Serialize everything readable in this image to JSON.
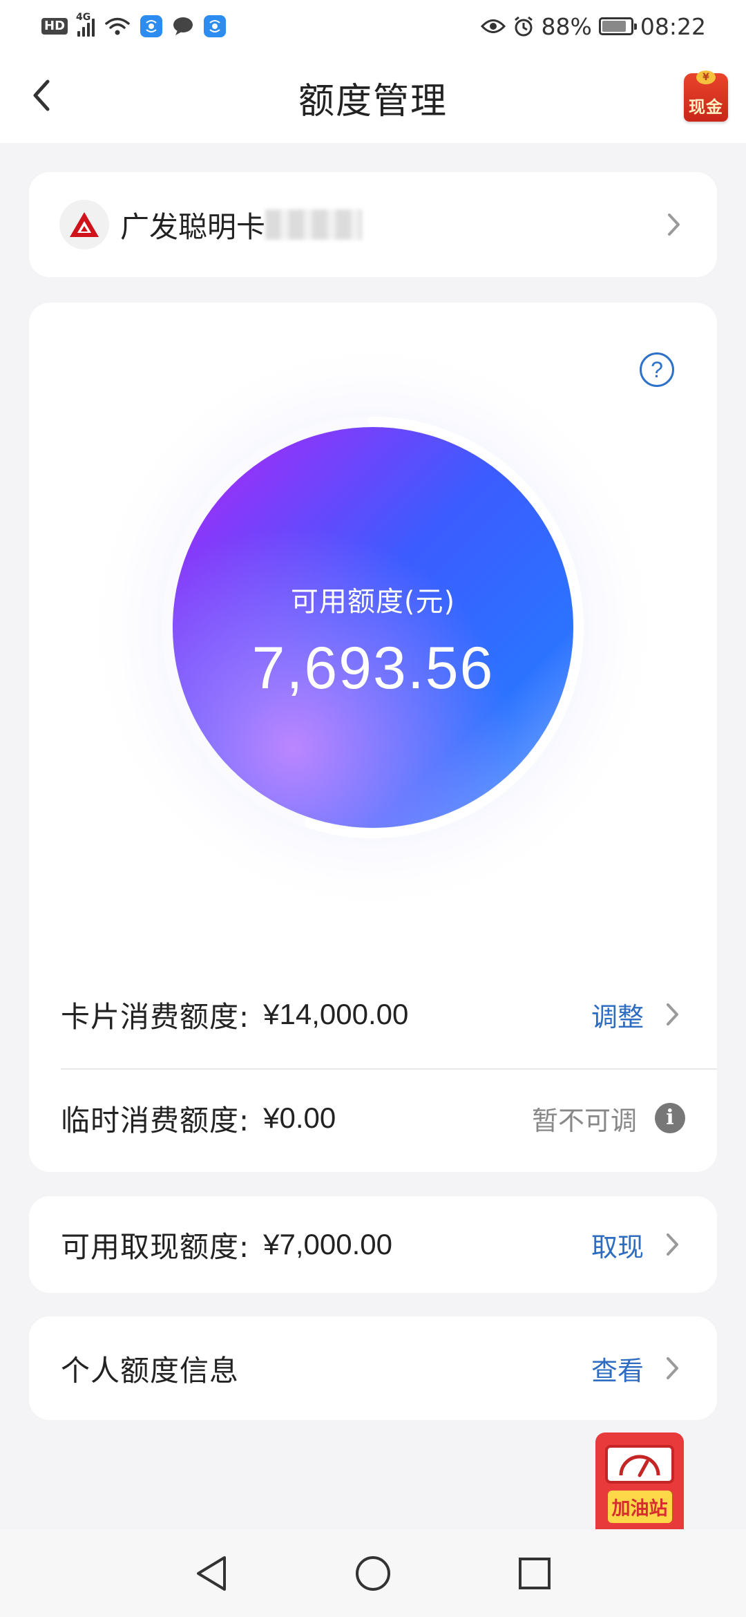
{
  "status_bar": {
    "hd": "HD",
    "network": "4G",
    "battery": "88%",
    "time": "08:22",
    "icons": [
      "signal-icon",
      "wifi-icon",
      "app-notification-icon",
      "message-icon",
      "app-notification-icon",
      "eye-icon",
      "alarm-icon",
      "battery-icon"
    ]
  },
  "header": {
    "title": "额度管理",
    "back_icon": "chevron-left-icon",
    "cash_button_label": "现金",
    "cash_coin_symbol": "¥"
  },
  "card_selector": {
    "bank_logo": "cgb-bank-logo-icon",
    "card_name": "广发聪明卡",
    "chevron": "chevron-right-icon"
  },
  "gauge": {
    "label": "可用额度(元)",
    "value": "7,693.56",
    "available_fraction": 0.55,
    "help_symbol": "?",
    "colors": {
      "purple": "#b325f5",
      "blue": "#2b6bff",
      "track": "#ffffff"
    }
  },
  "quota_rows": [
    {
      "label": "卡片消费额度:",
      "value": "¥14,000.00",
      "action": "调整",
      "enabled": true
    },
    {
      "label": "临时消费额度:",
      "value": "¥0.00",
      "action": "暂不可调",
      "enabled": false,
      "info_symbol": "i"
    }
  ],
  "withdraw": {
    "label": "可用取现额度:",
    "value": "¥7,000.00",
    "action": "取现"
  },
  "personal": {
    "label": "个人额度信息",
    "action": "查看"
  },
  "floating_ad": {
    "label": "加油站",
    "icon": "gauge-meter-icon"
  },
  "nav_bar": {
    "icons": [
      "nav-back-icon",
      "nav-home-icon",
      "nav-recents-icon"
    ]
  },
  "colors": {
    "accent": "#2d6cc0",
    "background": "#f4f4f6",
    "card": "#ffffff",
    "muted": "#888888",
    "ad_red": "#e83a3a",
    "ad_yellow": "#ffd84a"
  }
}
